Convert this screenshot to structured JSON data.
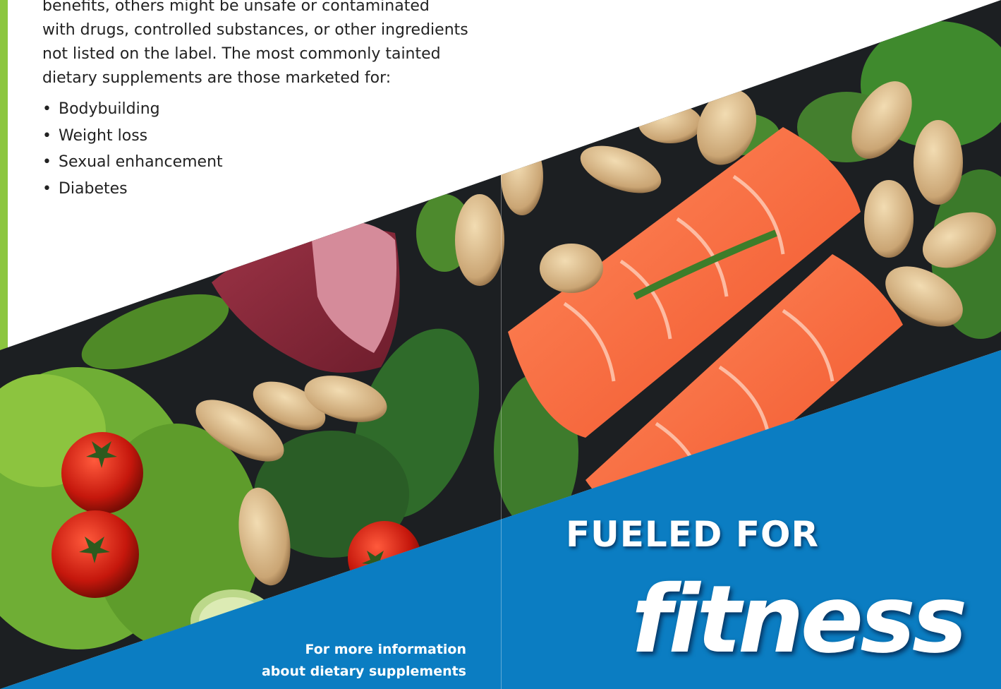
{
  "intro_lines": [
    "benefits, others might be unsafe or contaminated",
    "with drugs, controlled substances, or other ingredients",
    "not listed on the label. The most commonly tainted",
    "dietary supplements are those marketed for:"
  ],
  "bullets": [
    "Bodybuilding",
    "Weight loss",
    "Sexual enhancement",
    "Diabetes"
  ],
  "more_info_lines": [
    "For more information",
    "about dietary supplements"
  ],
  "title": {
    "line1": "FUELED FOR",
    "line2": "fitness"
  },
  "colors": {
    "accent_green": "#8cc63f",
    "panel_blue": "#0b7dc2",
    "text": "#222222"
  }
}
